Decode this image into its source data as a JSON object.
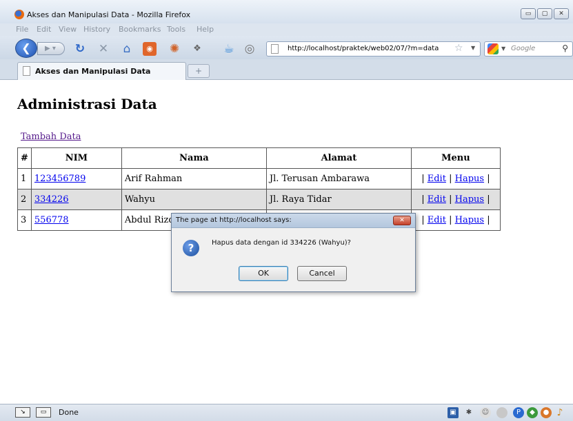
{
  "window": {
    "title": "Akses dan Manipulasi Data - Mozilla Firefox",
    "buttons": {
      "minimize": "▭",
      "maximize": "▢",
      "close": "✕"
    }
  },
  "menu": [
    "File",
    "Edit",
    "View",
    "History",
    "Bookmarks",
    "Tools",
    "Help"
  ],
  "toolbar": {
    "url": "http://localhost/praktek/web02/07/?m=data",
    "search_placeholder": "Google"
  },
  "tabs": [
    {
      "label": "Akses dan Manipulasi Data"
    }
  ],
  "page": {
    "title": "Administrasi Data",
    "add_link": "Tambah Data",
    "table": {
      "headers": [
        "#",
        "NIM",
        "Nama",
        "Alamat",
        "Menu"
      ],
      "rows": [
        {
          "no": "1",
          "nim": "123456789",
          "nama": "Arif Rahman",
          "alamat": "Jl. Terusan Ambarawa",
          "edit": "Edit",
          "hapus": "Hapus"
        },
        {
          "no": "2",
          "nim": "334226",
          "nama": "Wahyu",
          "alamat": "Jl. Raya Tidar",
          "edit": "Edit",
          "hapus": "Hapus"
        },
        {
          "no": "3",
          "nim": "556778",
          "nama": "Abdul Rizq",
          "alamat": "",
          "edit": "Edit",
          "hapus": "Hapus"
        }
      ],
      "menu_sep": "|"
    }
  },
  "dialog": {
    "title": "The page at http://localhost says:",
    "message": "Hapus data dengan id 334226 (Wahyu)?",
    "ok": "OK",
    "cancel": "Cancel",
    "icon": "question-icon"
  },
  "status": {
    "text": "Done"
  }
}
